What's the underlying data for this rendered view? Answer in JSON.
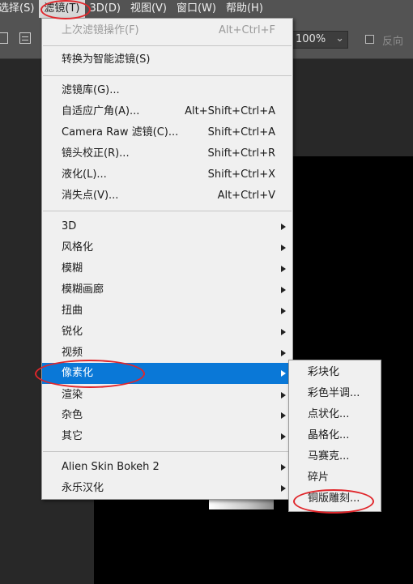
{
  "menubar": {
    "items": [
      "选择(S)",
      "滤镜(T)",
      "3D(D)",
      "视图(V)",
      "窗口(W)",
      "帮助(H)"
    ],
    "active_index": 1
  },
  "options_bar": {
    "zoom": "100%",
    "reverse_label": "反向",
    "reverse_checked": false
  },
  "filter_menu": {
    "items": [
      {
        "label": "上次滤镜操作(F)",
        "shortcut": "Alt+Ctrl+F",
        "disabled": true
      },
      {
        "label": "转换为智能滤镜(S)"
      },
      {
        "label": "滤镜库(G)..."
      },
      {
        "label": "自适应广角(A)...",
        "shortcut": "Alt+Shift+Ctrl+A"
      },
      {
        "label": "Camera Raw 滤镜(C)...",
        "shortcut": "Shift+Ctrl+A"
      },
      {
        "label": "镜头校正(R)...",
        "shortcut": "Shift+Ctrl+R"
      },
      {
        "label": "液化(L)...",
        "shortcut": "Shift+Ctrl+X"
      },
      {
        "label": "消失点(V)...",
        "shortcut": "Alt+Ctrl+V"
      },
      {
        "label": "3D",
        "submenu": true
      },
      {
        "label": "风格化",
        "submenu": true
      },
      {
        "label": "模糊",
        "submenu": true
      },
      {
        "label": "模糊画廊",
        "submenu": true
      },
      {
        "label": "扭曲",
        "submenu": true
      },
      {
        "label": "锐化",
        "submenu": true
      },
      {
        "label": "视频",
        "submenu": true
      },
      {
        "label": "像素化",
        "submenu": true,
        "highlighted": true
      },
      {
        "label": "渲染",
        "submenu": true
      },
      {
        "label": "杂色",
        "submenu": true
      },
      {
        "label": "其它",
        "submenu": true
      },
      {
        "label": "Alien Skin Bokeh 2",
        "submenu": true
      },
      {
        "label": "永乐汉化",
        "submenu": true
      }
    ]
  },
  "pixelate_submenu": {
    "items": [
      "彩块化",
      "彩色半调...",
      "点状化...",
      "晶格化...",
      "马赛克...",
      "碎片",
      "铜版雕刻..."
    ]
  },
  "colors": {
    "highlight": "#0a78d7",
    "annotation": "#e0262b",
    "menu_bg": "#f0f0f0",
    "menubar_bg": "#535353"
  }
}
